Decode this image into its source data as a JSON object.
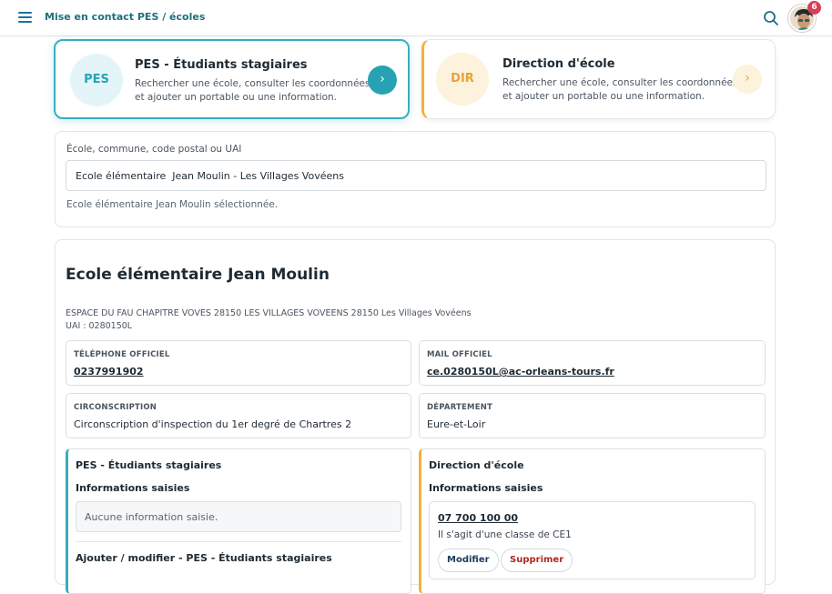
{
  "topbar": {
    "title": "Mise en contact PES / écoles",
    "notifications": "6"
  },
  "modes": [
    {
      "code": "PES",
      "title": "PES - Étudiants stagiaires",
      "description": "Rechercher une école, consulter les coordonnées et ajouter un portable ou une information.",
      "arrow": "›"
    },
    {
      "code": "DIR",
      "title": "Direction d'école",
      "description": "Rechercher une école, consulter les coordonnées et ajouter un portable ou une information.",
      "arrow": "›"
    }
  ],
  "search": {
    "label": "École, commune, code postal ou UAI",
    "value": "Ecole élémentaire  Jean Moulin - Les Villages Vovéens",
    "selected_message": "Ecole élémentaire Jean Moulin sélectionnée."
  },
  "school": {
    "name": "Ecole élémentaire Jean Moulin",
    "address": "ESPACE DU FAU CHAPITRE VOVES 28150 LES VILLAGES VOVEENS 28150 Les Villages Vovéens",
    "uai": "UAI : 0280150L",
    "phone_label": "TÉLÉPHONE OFFICIEL",
    "phone": "0237991902",
    "mail_label": "MAIL OFFICIEL",
    "mail": "ce.0280150L@ac-orleans-tours.fr",
    "circ_label": "CIRCONSCRIPTION",
    "circ": "Circonscription d'inspection du 1er degré de Chartres 2",
    "dept_label": "DÉPARTEMENT",
    "dept": "Eure-et-Loir"
  },
  "pes_section": {
    "title": "PES - Étudiants stagiaires",
    "info_title": "Informations saisies",
    "empty": "Aucune information saisie.",
    "edit_title": "Ajouter / modifier - PES - Étudiants stagiaires"
  },
  "dir_section": {
    "title": "Direction d'école",
    "info_title": "Informations saisies",
    "entry_phone": "07 700 100 00",
    "entry_note": "Il s'agit d'une classe de CE1",
    "edit_label": "Modifier",
    "delete_label": "Supprimer"
  },
  "colors": {
    "teal": "#27a2b4",
    "amber": "#f0b23a",
    "badge": "#d63f57"
  }
}
